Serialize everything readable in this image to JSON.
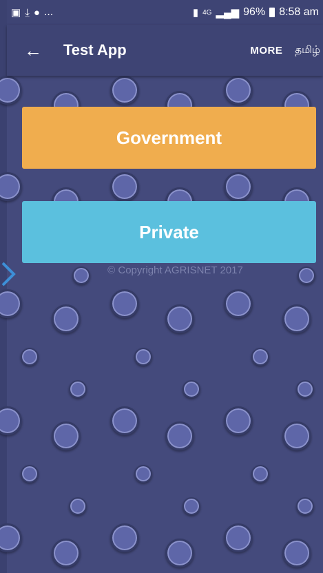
{
  "status_bar": {
    "left_icons": [
      "image-icon",
      "download-icon",
      "phone-icon"
    ],
    "left_more": "...",
    "network": "4G",
    "battery": "96%",
    "time": "8:58 am"
  },
  "app_bar": {
    "title": "Test App",
    "more_label": "MORE",
    "language_label": "தமிழ்"
  },
  "cards": {
    "government": "Government",
    "private": "Private"
  },
  "footer": {
    "copyright": "© Copyright AGRISNET 2017"
  },
  "colors": {
    "background": "#444a7c",
    "government": "#f0ad4e",
    "private": "#5bc0de"
  }
}
